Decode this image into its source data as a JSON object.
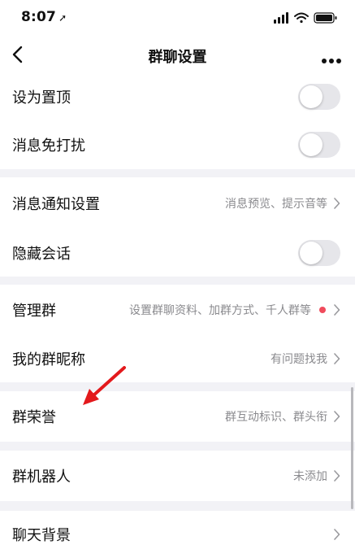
{
  "status_bar": {
    "time": "8:07",
    "location_glyph": "➚",
    "icons": [
      "signal-icon",
      "wifi-icon",
      "battery-icon"
    ]
  },
  "nav": {
    "title": "群聊设置",
    "back_icon": "chevron-left-icon",
    "more_icon": "more-icon"
  },
  "settings": {
    "pin_top": {
      "label": "设为置顶",
      "enabled": false
    },
    "mute": {
      "label": "消息免打扰",
      "enabled": false
    },
    "notification_settings": {
      "label": "消息通知设置",
      "value": "消息预览、提示音等"
    },
    "hide_chat": {
      "label": "隐藏会话",
      "enabled": false
    },
    "manage_group": {
      "label": "管理群",
      "value": "设置群聊资料、加群方式、千人群等",
      "has_red_dot": true
    },
    "my_nickname": {
      "label": "我的群昵称",
      "value": "有问题找我"
    },
    "group_honor": {
      "label": "群荣誉",
      "value": "群互动标识、群头衔"
    },
    "group_robot": {
      "label": "群机器人",
      "value": "未添加"
    },
    "chat_background": {
      "label": "聊天背景",
      "value": ""
    }
  },
  "colors": {
    "background": "#f2f2f6",
    "row_background": "#ffffff",
    "toggle_off": "#e6e6ea",
    "red_dot": "#f04b5c",
    "annotation_arrow": "#e3191c",
    "secondary_text": "#8a8a8e"
  }
}
